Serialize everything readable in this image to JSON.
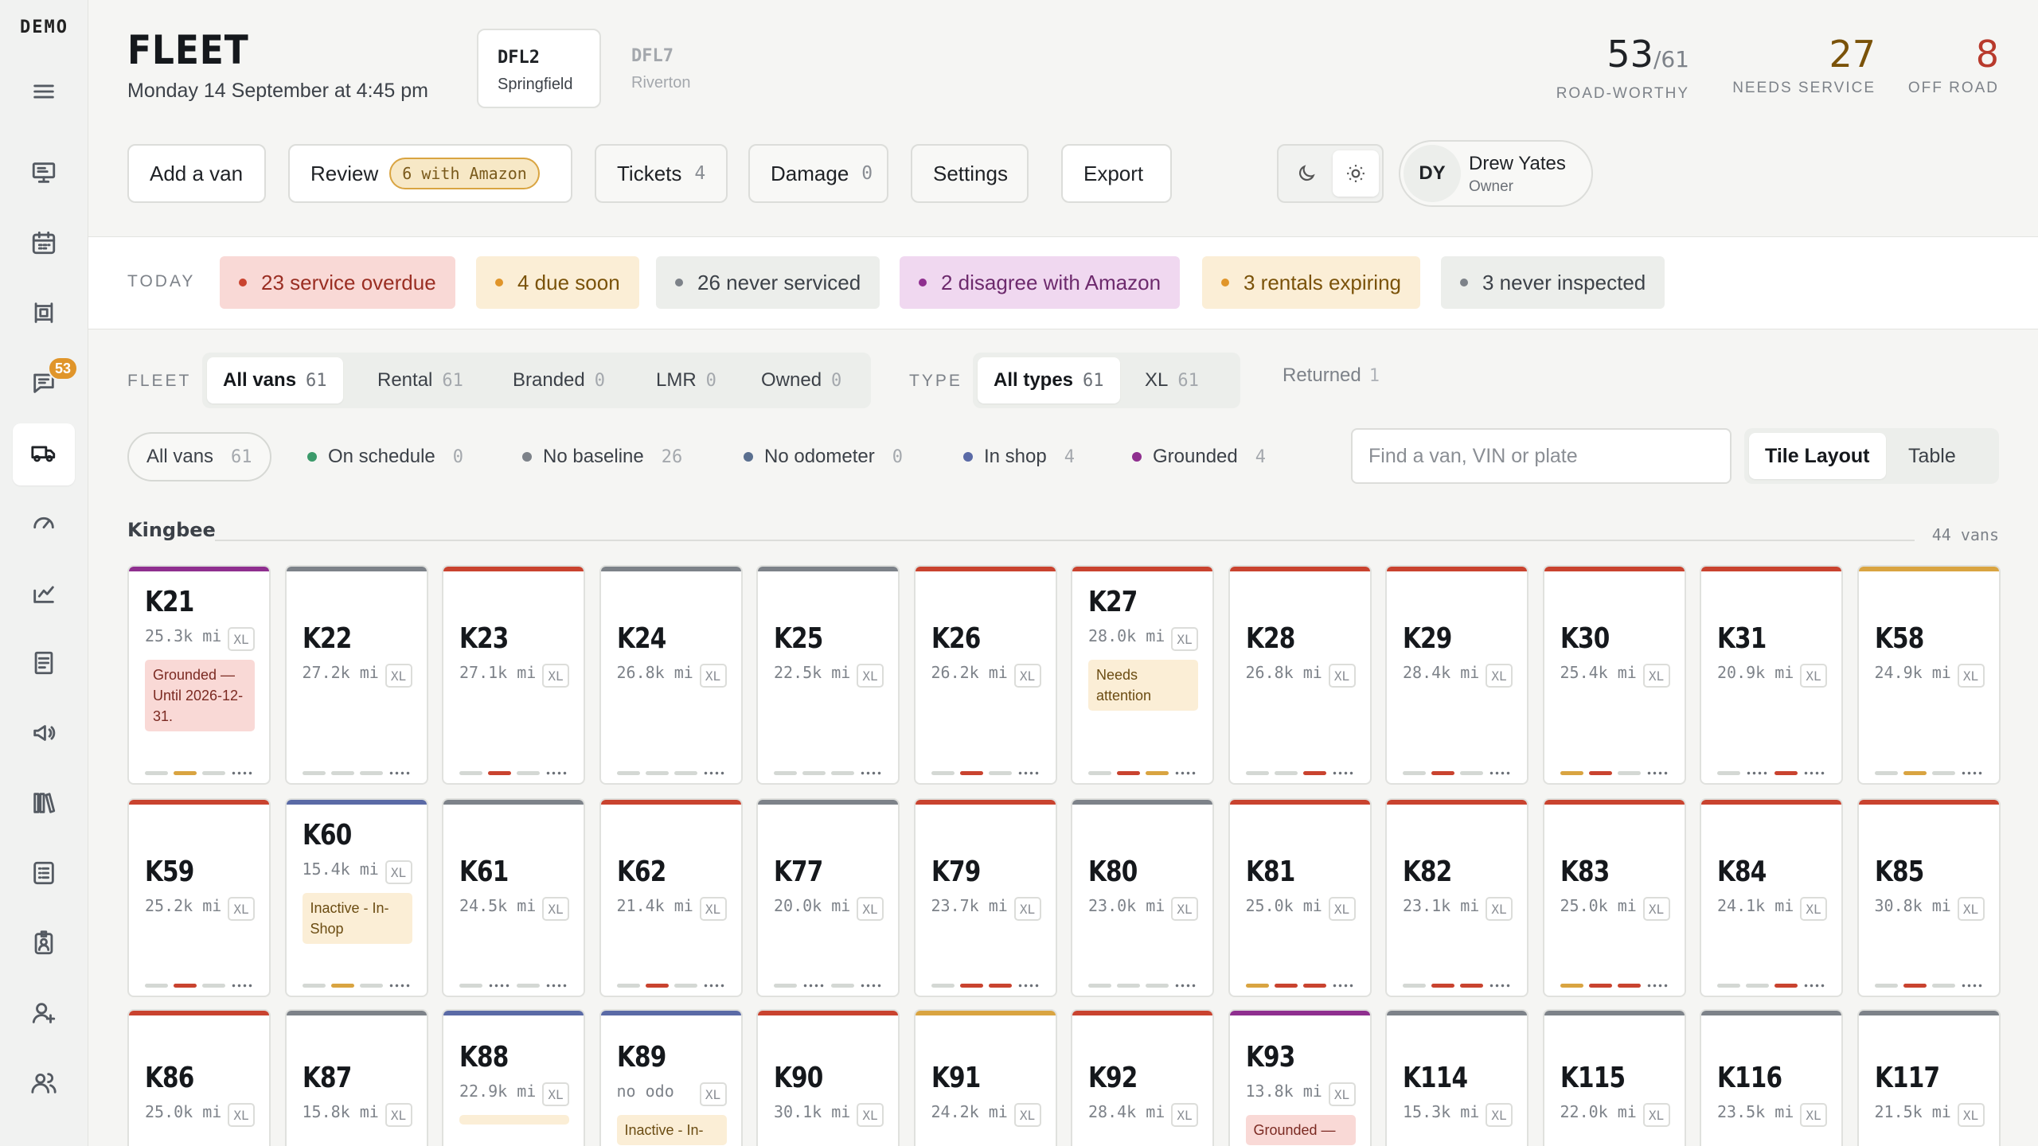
{
  "app": {
    "brand": "DEMO"
  },
  "nav": {
    "items": [
      {
        "name": "nav-menu-icon",
        "icon": "hamburger"
      },
      {
        "name": "nav-dashboard-icon",
        "icon": "monitor"
      },
      {
        "name": "nav-calendar-icon",
        "icon": "calendar"
      },
      {
        "name": "nav-board-icon",
        "icon": "board"
      },
      {
        "name": "nav-messages-icon",
        "icon": "chat",
        "badge": "53"
      },
      {
        "name": "nav-fleet-icon",
        "icon": "van",
        "active": true
      },
      {
        "name": "nav-speed-icon",
        "icon": "gauge"
      },
      {
        "name": "nav-analytics-icon",
        "icon": "chart"
      },
      {
        "name": "nav-reports-icon",
        "icon": "receipt"
      },
      {
        "name": "nav-announce-icon",
        "icon": "megaphone"
      },
      {
        "name": "nav-library-icon",
        "icon": "books"
      },
      {
        "name": "nav-checklist-icon",
        "icon": "list"
      },
      {
        "name": "nav-badge-icon",
        "icon": "id-badge"
      },
      {
        "name": "nav-add-user-icon",
        "icon": "user-plus"
      },
      {
        "name": "nav-team-icon",
        "icon": "users"
      }
    ]
  },
  "header": {
    "title": "FLEET",
    "date": "Monday 14 September at 4:45 pm",
    "stations": [
      {
        "code": "DFL2",
        "city": "Springfield",
        "active": true
      },
      {
        "code": "DFL7",
        "city": "Riverton",
        "active": false
      }
    ],
    "stats": [
      {
        "value": "53",
        "of": "/61",
        "label": "ROAD-WORTHY",
        "color": "#1f2226"
      },
      {
        "value": "27",
        "of": "",
        "label": "NEEDS SERVICE",
        "color": "#7a5209"
      },
      {
        "value": "8",
        "of": "",
        "label": "OFF ROAD",
        "color": "#b83a2c"
      }
    ],
    "buttons": {
      "add_van": "Add a van",
      "review": "Review",
      "review_pill": "6 with Amazon",
      "tickets": "Tickets",
      "tickets_count": "4",
      "damage": "Damage",
      "damage_count": "0",
      "settings": "Settings",
      "export": "Export"
    },
    "user": {
      "initials": "DY",
      "name": "Drew Yates",
      "role": "Owner"
    }
  },
  "today": {
    "label": "TODAY",
    "alerts": [
      {
        "text": "23 service overdue",
        "bg": "#f9d9d6",
        "fg": "#9a2e23",
        "dot": "#c9432f"
      },
      {
        "text": "4 due soon",
        "bg": "#fbeed6",
        "fg": "#7a5209",
        "dot": "#e0952a"
      },
      {
        "text": "26 never serviced",
        "bg": "#eceeeb",
        "fg": "#3c4148",
        "dot": "#7d8289"
      },
      {
        "text": "2 disagree with Amazon",
        "bg": "#f0d8f0",
        "fg": "#6d2a6d",
        "dot": "#8f2f8f"
      },
      {
        "text": "3 rentals expiring",
        "bg": "#fbeed6",
        "fg": "#7a5209",
        "dot": "#e0952a"
      },
      {
        "text": "3 never inspected",
        "bg": "#eceeeb",
        "fg": "#3c4148",
        "dot": "#7d8289"
      }
    ]
  },
  "filters": {
    "fleet_label": "FLEET",
    "fleet": [
      {
        "label": "All vans",
        "count": "61",
        "on": true
      },
      {
        "label": "Rental",
        "count": "61"
      },
      {
        "label": "Branded",
        "count": "0"
      },
      {
        "label": "LMR",
        "count": "0"
      },
      {
        "label": "Owned",
        "count": "0"
      }
    ],
    "type_label": "TYPE",
    "types": [
      {
        "label": "All types",
        "count": "61",
        "on": true
      },
      {
        "label": "XL",
        "count": "61"
      }
    ],
    "returned": {
      "label": "Returned",
      "count": "1"
    },
    "status": [
      {
        "label": "All vans",
        "count": "61",
        "dot": "",
        "on": true
      },
      {
        "label": "On schedule",
        "count": "0",
        "dot": "#3b9a6a"
      },
      {
        "label": "No baseline",
        "count": "26",
        "dot": "#7d8289"
      },
      {
        "label": "No odometer",
        "count": "0",
        "dot": "#5a6f8f"
      },
      {
        "label": "In shop",
        "count": "4",
        "dot": "#5a6aa6"
      },
      {
        "label": "Grounded",
        "count": "4",
        "dot": "#8f2f8f"
      }
    ],
    "search_placeholder": "Find a van, VIN or plate",
    "layouts": [
      {
        "label": "Tile Layout",
        "on": true
      },
      {
        "label": "Table"
      }
    ]
  },
  "group": {
    "name": "Kingbee",
    "count": "44 vans",
    "rows": [
      [
        {
          "code": "K21",
          "odo": "25.3k mi",
          "tag": "XL",
          "top": "#8f2f8f",
          "note": "Grounded — Until 2026-12-31.",
          "noteType": "red",
          "segs": [
            "#d4d8d4",
            "#d9a441",
            "#d4d8d4"
          ]
        },
        {
          "code": "K22",
          "odo": "27.2k mi",
          "tag": "XL",
          "top": "#7d8289",
          "segs": [
            "#d4d8d4",
            "#d4d8d4",
            "#d4d8d4"
          ]
        },
        {
          "code": "K23",
          "odo": "27.1k mi",
          "tag": "XL",
          "top": "#c9432f",
          "segs": [
            "#d4d8d4",
            "#c9432f",
            "#d4d8d4"
          ]
        },
        {
          "code": "K24",
          "odo": "26.8k mi",
          "tag": "XL",
          "top": "#7d8289",
          "segs": [
            "#d4d8d4",
            "#d4d8d4",
            "#d4d8d4"
          ]
        },
        {
          "code": "K25",
          "odo": "22.5k mi",
          "tag": "XL",
          "top": "#7d8289",
          "segs": [
            "#d4d8d4",
            "#d4d8d4",
            "#d4d8d4"
          ]
        },
        {
          "code": "K26",
          "odo": "26.2k mi",
          "tag": "XL",
          "top": "#c9432f",
          "segs": [
            "#d4d8d4",
            "#c9432f",
            "#d4d8d4"
          ]
        },
        {
          "code": "K27",
          "odo": "28.0k mi",
          "tag": "XL",
          "top": "#c9432f",
          "note": "Needs attention",
          "noteType": "amb",
          "segs": [
            "#d4d8d4",
            "#c9432f",
            "#d9a441"
          ]
        },
        {
          "code": "K28",
          "odo": "26.8k mi",
          "tag": "XL",
          "top": "#c9432f",
          "segs": [
            "#d4d8d4",
            "#d4d8d4",
            "#c9432f"
          ]
        },
        {
          "code": "K29",
          "odo": "28.4k mi",
          "tag": "XL",
          "top": "#c9432f",
          "segs": [
            "#d4d8d4",
            "#c9432f",
            "#d4d8d4"
          ]
        },
        {
          "code": "K30",
          "odo": "25.4k mi",
          "tag": "XL",
          "top": "#c9432f",
          "segs": [
            "#d9a441",
            "#c9432f",
            "#d4d8d4"
          ]
        },
        {
          "code": "K31",
          "odo": "20.9k mi",
          "tag": "XL",
          "top": "#c9432f",
          "segs": [
            "#d4d8d4",
            "dots",
            "#c9432f"
          ]
        },
        {
          "code": "K58",
          "odo": "24.9k mi",
          "tag": "XL",
          "top": "#d9a441",
          "segs": [
            "#d4d8d4",
            "#d9a441",
            "#d4d8d4"
          ]
        }
      ],
      [
        {
          "code": "K59",
          "odo": "25.2k mi",
          "tag": "XL",
          "top": "#c9432f",
          "segs": [
            "#d4d8d4",
            "#c9432f",
            "#d4d8d4"
          ]
        },
        {
          "code": "K60",
          "odo": "15.4k mi",
          "tag": "XL",
          "top": "#5a6aa6",
          "note": "Inactive - In-Shop",
          "noteType": "amb",
          "segs": [
            "#d4d8d4",
            "#d9a441",
            "#d4d8d4"
          ]
        },
        {
          "code": "K61",
          "odo": "24.5k mi",
          "tag": "XL",
          "top": "#7d8289",
          "segs": [
            "#d4d8d4",
            "dots",
            "#d4d8d4"
          ]
        },
        {
          "code": "K62",
          "odo": "21.4k mi",
          "tag": "XL",
          "top": "#c9432f",
          "segs": [
            "#d4d8d4",
            "#c9432f",
            "#d4d8d4"
          ]
        },
        {
          "code": "K77",
          "odo": "20.0k mi",
          "tag": "XL",
          "top": "#7d8289",
          "segs": [
            "#d4d8d4",
            "dots",
            "#d4d8d4"
          ]
        },
        {
          "code": "K79",
          "odo": "23.7k mi",
          "tag": "XL",
          "top": "#c9432f",
          "segs": [
            "#d4d8d4",
            "#c9432f",
            "#c9432f"
          ]
        },
        {
          "code": "K80",
          "odo": "23.0k mi",
          "tag": "XL",
          "top": "#7d8289",
          "segs": [
            "#d4d8d4",
            "#d4d8d4",
            "#d4d8d4"
          ]
        },
        {
          "code": "K81",
          "odo": "25.0k mi",
          "tag": "XL",
          "top": "#c9432f",
          "segs": [
            "#d9a441",
            "#c9432f",
            "#c9432f"
          ]
        },
        {
          "code": "K82",
          "odo": "23.1k mi",
          "tag": "XL",
          "top": "#c9432f",
          "segs": [
            "#d4d8d4",
            "#c9432f",
            "#c9432f"
          ]
        },
        {
          "code": "K83",
          "odo": "25.0k mi",
          "tag": "XL",
          "top": "#c9432f",
          "segs": [
            "#d9a441",
            "#c9432f",
            "#c9432f"
          ]
        },
        {
          "code": "K84",
          "odo": "24.1k mi",
          "tag": "XL",
          "top": "#c9432f",
          "segs": [
            "#d4d8d4",
            "#d4d8d4",
            "#c9432f"
          ]
        },
        {
          "code": "K85",
          "odo": "30.8k mi",
          "tag": "XL",
          "top": "#c9432f",
          "segs": [
            "#d4d8d4",
            "#c9432f",
            "#d4d8d4"
          ]
        }
      ],
      [
        {
          "code": "K86",
          "odo": "25.0k mi",
          "tag": "XL",
          "top": "#c9432f"
        },
        {
          "code": "K87",
          "odo": "15.8k mi",
          "tag": "XL",
          "top": "#7d8289"
        },
        {
          "code": "K88",
          "odo": "22.9k mi",
          "tag": "XL",
          "top": "#5a6aa6",
          "note": " ",
          "noteType": "amb"
        },
        {
          "code": "K89",
          "odo": "no odo",
          "tag": "XL",
          "top": "#5a6aa6",
          "note": "Inactive - In-",
          "noteType": "amb"
        },
        {
          "code": "K90",
          "odo": "30.1k mi",
          "tag": "XL",
          "top": "#c9432f"
        },
        {
          "code": "K91",
          "odo": "24.2k mi",
          "tag": "XL",
          "top": "#d9a441"
        },
        {
          "code": "K92",
          "odo": "28.4k mi",
          "tag": "XL",
          "top": "#c9432f"
        },
        {
          "code": "K93",
          "odo": "13.8k mi",
          "tag": "XL",
          "top": "#8f2f8f",
          "note": "Grounded —",
          "noteType": "red"
        },
        {
          "code": "K114",
          "odo": "15.3k mi",
          "tag": "XL",
          "top": "#7d8289"
        },
        {
          "code": "K115",
          "odo": "22.0k mi",
          "tag": "XL",
          "top": "#7d8289"
        },
        {
          "code": "K116",
          "odo": "23.5k mi",
          "tag": "XL",
          "top": "#7d8289"
        },
        {
          "code": "K117",
          "odo": "21.5k mi",
          "tag": "XL",
          "top": "#7d8289"
        }
      ]
    ]
  }
}
